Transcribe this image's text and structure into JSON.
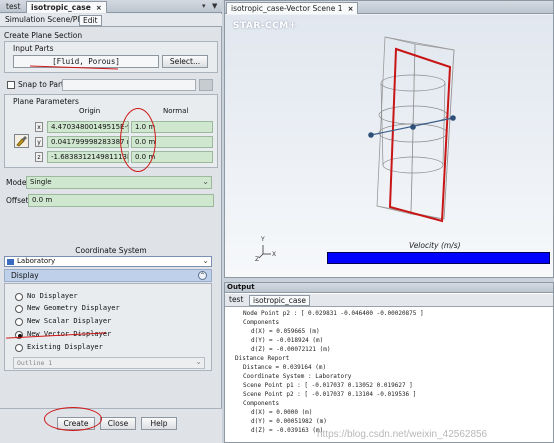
{
  "left_panel": {
    "tabs": [
      {
        "label": "test"
      },
      {
        "label": "isotropic_case",
        "close": "×"
      }
    ],
    "tab_controls": [
      "▾",
      "▼"
    ],
    "subtabs": [
      "Simulation Scene/Plot",
      "Edit"
    ],
    "section_title": "Create Plane Section",
    "input_parts": {
      "title": "Input Parts",
      "value": "[Fluid, Porous]",
      "select_label": "Select..."
    },
    "snap_to_part": {
      "label": "Snap to Part",
      "checked": false
    },
    "plane_parameters": {
      "title": "Plane Parameters",
      "col_origin": "Origin",
      "col_normal": "Normal",
      "rows": [
        {
          "axis": "x",
          "origin": "4.47034800149515E-9 m",
          "normal": "1.0 m"
        },
        {
          "axis": "y",
          "origin": "0.041799998283387 m",
          "normal": "0.0 m"
        },
        {
          "axis": "z",
          "origin": "-1.683831214981113E-7 m",
          "normal": "0.0 m"
        }
      ]
    },
    "mode": {
      "label": "Mode",
      "value": "Single"
    },
    "offset": {
      "label": "Offset",
      "value": "0.0 m"
    },
    "coordinate_system": {
      "title": "Coordinate System",
      "value": "Laboratory"
    },
    "display": {
      "title": "Display",
      "options": [
        {
          "label": "No Displayer",
          "selected": false
        },
        {
          "label": "New Geometry Displayer",
          "selected": false
        },
        {
          "label": "New Scalar Displayer",
          "selected": false
        },
        {
          "label": "New Vector Displayer",
          "selected": true
        },
        {
          "label": "Existing Displayer",
          "selected": false
        }
      ],
      "existing_value": "Outline 1"
    },
    "buttons": {
      "create": "Create",
      "close": "Close",
      "help": "Help"
    }
  },
  "scene": {
    "tab_label": "isotropic_case-Vector Scene 1",
    "tab_close": "×",
    "logo": "STAR-CCM+",
    "colorbar_label": "Velocity (m/s)",
    "colorbar_color": "#0000ff",
    "axes": {
      "x": "X",
      "y": "Y",
      "z": "Z"
    }
  },
  "output": {
    "title": "Output",
    "tabs": [
      "test",
      "isotropic_case"
    ],
    "lines": [
      "Node Point p2 : [ 0.029831 -0.046400 -0.00020875 ]",
      "Components",
      "d(X) = 0.059665 (m)",
      "d(Y) = -0.018924 (m)",
      "d(Z) = -0.00072121 (m)",
      "Distance Report",
      "Distance = 0.039164 (m)",
      "Coordinate System : Laboratory",
      "Scene Point p1 : [ -0.017037 0.13052 0.019627 ]",
      "Scene Point p2 : [ -0.017037 0.13104 -0.019536 ]",
      "Components",
      "d(X) = 0.0000 (m)",
      "d(Y) = 0.00051982 (m)",
      "d(Z) = -0.039163 (m)"
    ],
    "watermark": "https://blog.csdn.net/weixin_42562856"
  },
  "colors": {
    "annotation_red": "#d01818",
    "field_green": "#cfe6cf",
    "selection_blue": "#3c6ec8"
  }
}
